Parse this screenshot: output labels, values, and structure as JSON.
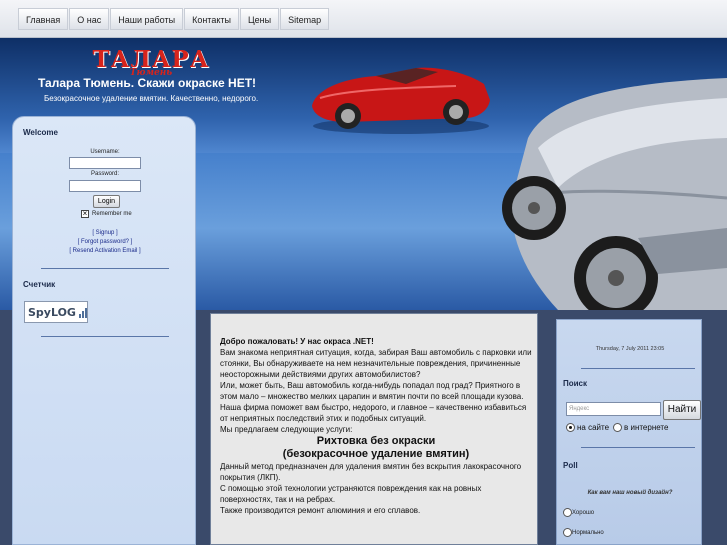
{
  "nav": {
    "items": [
      {
        "label": "Главная"
      },
      {
        "label": "О нас"
      },
      {
        "label": "Наши работы"
      },
      {
        "label": "Контакты"
      },
      {
        "label": "Цены"
      },
      {
        "label": "Sitemap"
      }
    ]
  },
  "header": {
    "logo_main": "ТАЛАРА",
    "logo_sub": "Тюмень",
    "title": "Талара Тюмень. Скажи окраске НЕТ!",
    "tagline": "Безокрасочное удаление вмятин. Качественно, недорого."
  },
  "login": {
    "heading": "Welcome",
    "username_label": "Username:",
    "password_label": "Password:",
    "login_button": "Login",
    "remember_label": "Remember me",
    "signup": "[ Signup ]",
    "forgot": "[ Forgot password? ]",
    "resend": "[ Resend Activation Email ]"
  },
  "counter": {
    "heading": "Счетчик",
    "badge_text": "SpyLOG"
  },
  "content": {
    "welcome": "Добро пожаловать! У нас окраса .NET!",
    "p1": "Вам знакома неприятная ситуация, когда, забирая Ваш автомобиль с парковки или стоянки, Вы обнаруживаете на нем незначительные повреждения, причиненные неосторожными действиями других автомобилистов?",
    "p2": "Или, может быть, Ваш автомобиль когда-нибудь попадал под град? Приятного в этом мало – множество мелких царапин и вмятин почти по всей площади кузова.",
    "p3": "Наша фирма поможет вам быстро, недорого, и главное – качественно избавиться от неприятных последствий этих и подобных ситуаций.",
    "p4": "Мы предлагаем следующие услуги:",
    "service_title": "Рихтовка без окраски",
    "service_subtitle": "(безокрасочное удаление вмятин)",
    "p5": "Данный метод предназначен для удаления вмятин без вскрытия лакокрасочного покрытия (ЛКП).",
    "p6": "С помощью этой технологии устраняются повреждения как на ровных поверхностях, так и на ребрах.",
    "p7": "Также производится ремонт алюминия и его сплавов."
  },
  "right": {
    "date": "Thursday, 7 July 2011 23:05",
    "search_heading": "Поиск",
    "search_placeholder": "Яндекс",
    "search_button": "Найти",
    "scope_site": "на сайте",
    "scope_web": "в интернете",
    "poll_heading": "Poll",
    "poll_question": "Как вам наш новый дизайн?",
    "poll_options": [
      "Хорошо",
      "Нормально"
    ]
  },
  "colors": {
    "accent_red": "#d7241c",
    "header_blue": "#2f63ad",
    "panel_blue": "#c9daf2"
  }
}
